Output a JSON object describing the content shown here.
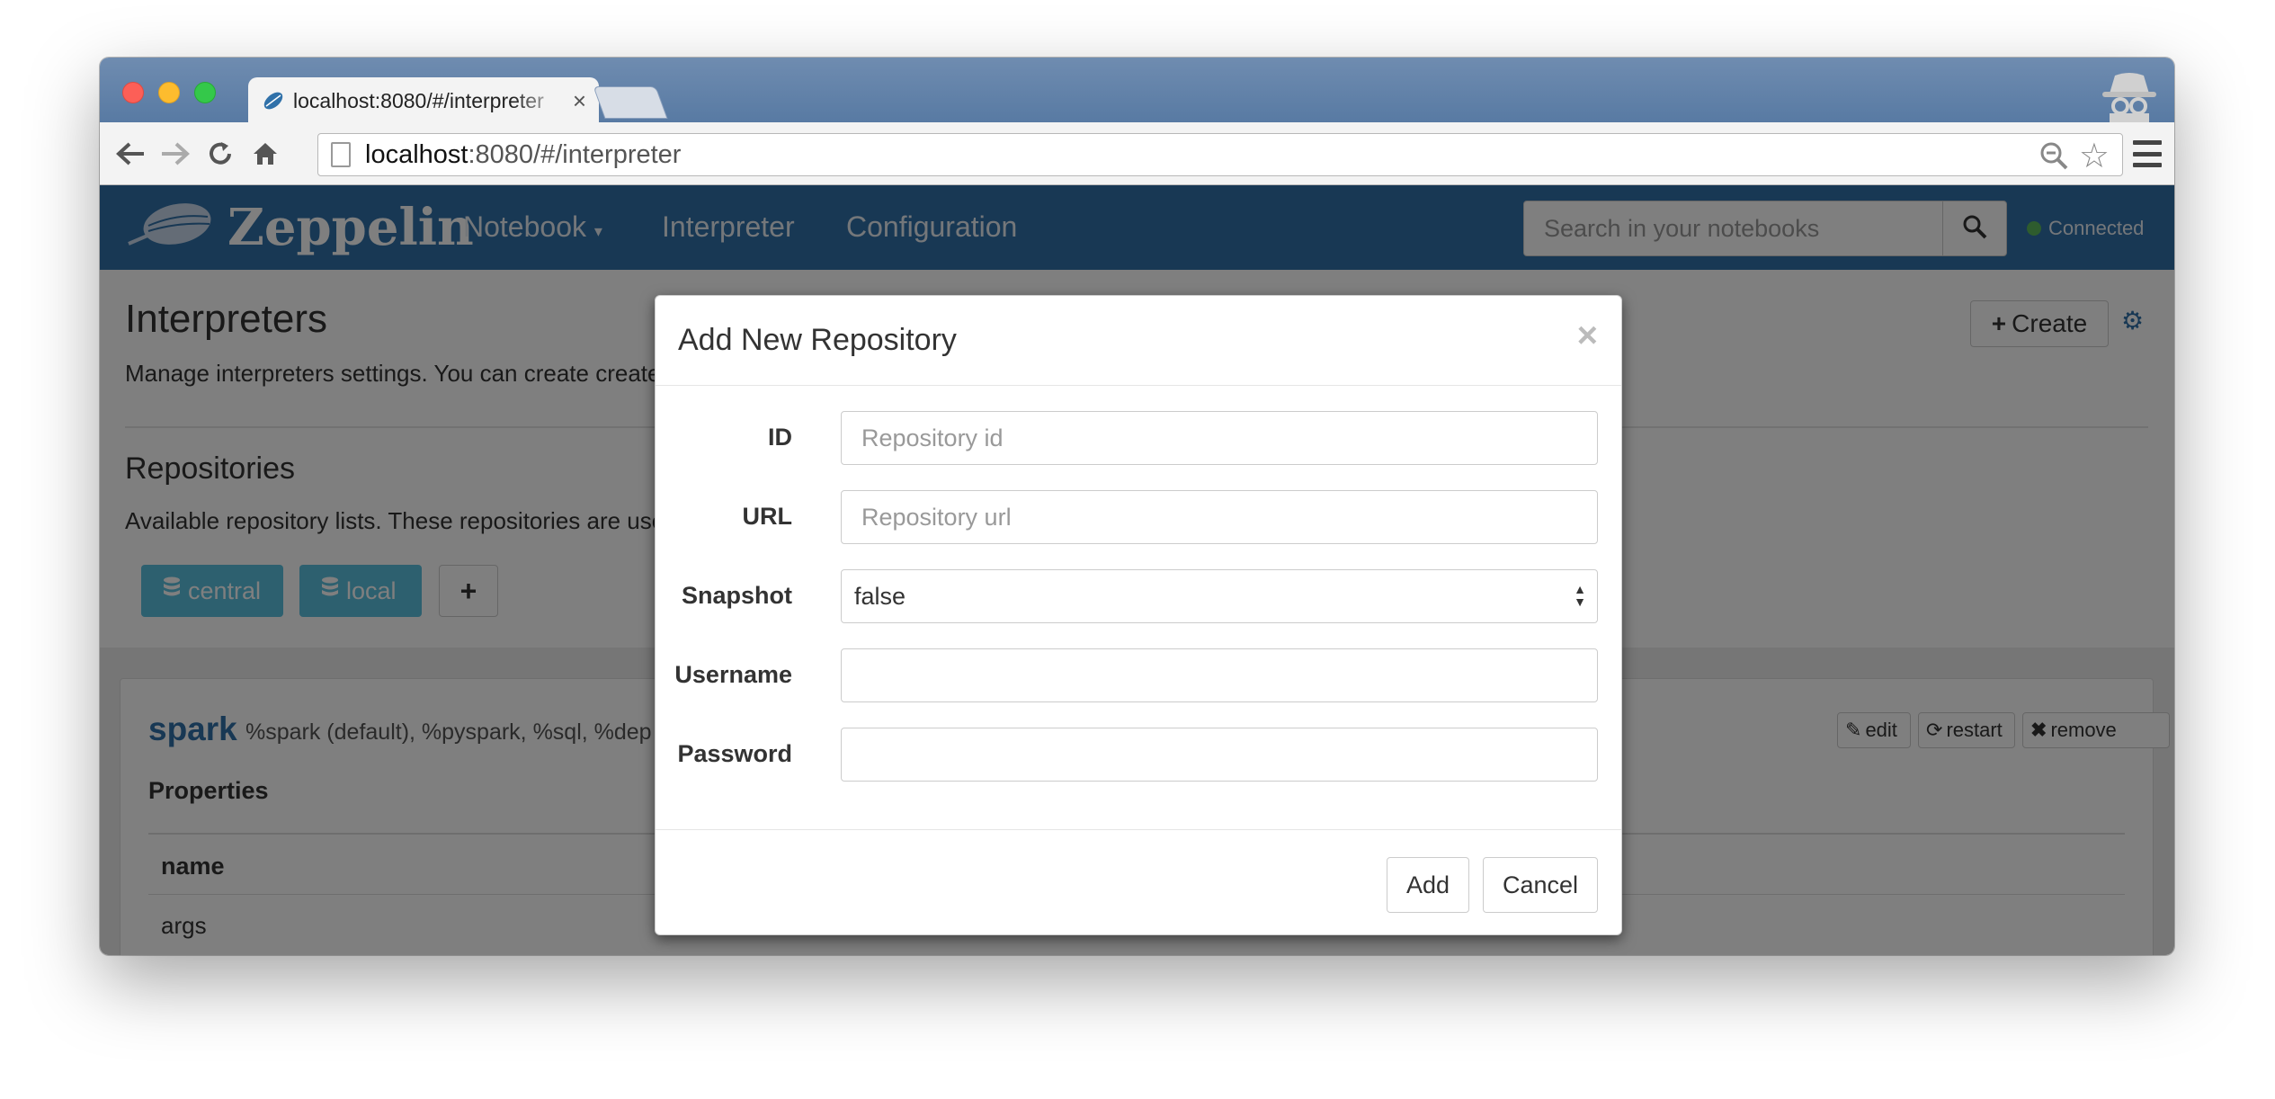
{
  "browser": {
    "tab_title": "localhost:8080/#/interpreter",
    "tab_close": "×",
    "url_host": "localhost",
    "url_path": ":8080/#/interpreter"
  },
  "app_nav": {
    "brand": "Zeppelin",
    "links": [
      "Notebook",
      "Interpreter",
      "Configuration"
    ],
    "search_placeholder": "Search in your notebooks",
    "status": "Connected",
    "status_color": "#5cb85c",
    "nav_color": "#3071a9"
  },
  "page": {
    "title": "Interpreters",
    "description": "Manage interpreters settings. You can create create /",
    "create_label": "Create",
    "repositories": {
      "title": "Repositories",
      "description": "Available repository lists. These repositories are used",
      "items": [
        "central",
        "local"
      ],
      "add_label": "+"
    },
    "interpreter": {
      "name": "spark",
      "aliases": "%spark (default), %pyspark, %sql, %dep",
      "actions": [
        "edit",
        "restart",
        "remove"
      ],
      "properties_label": "Properties",
      "column_name": "name",
      "rows": [
        "args"
      ]
    }
  },
  "modal": {
    "title": "Add New Repository",
    "close": "×",
    "fields": [
      {
        "label": "ID",
        "placeholder": "Repository id",
        "value": ""
      },
      {
        "label": "URL",
        "placeholder": "Repository url",
        "value": ""
      },
      {
        "label": "Snapshot",
        "value": "false"
      },
      {
        "label": "Username",
        "value": ""
      },
      {
        "label": "Password",
        "value": ""
      }
    ],
    "add_label": "Add",
    "cancel_label": "Cancel"
  }
}
